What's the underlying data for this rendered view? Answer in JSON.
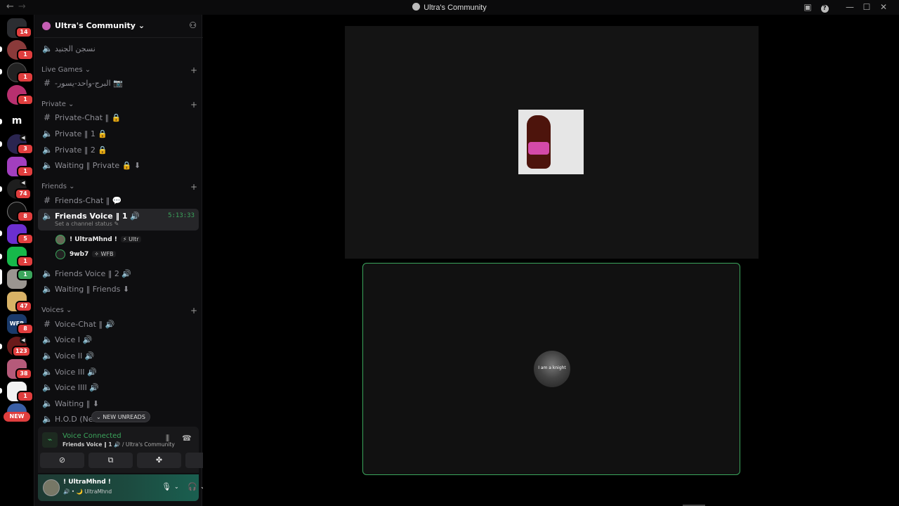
{
  "titlebar": {
    "back": "←",
    "forward": "→",
    "title": "Ultra's Community",
    "inbox_icon": "▣",
    "help_icon": "?",
    "minimize": "—",
    "maximize": "☐",
    "close": "✕"
  },
  "rail": {
    "badges": [
      "14",
      "1",
      "1",
      "1",
      "3",
      "1",
      "74",
      "8",
      "5",
      "1",
      "1",
      "47",
      "8",
      "123",
      "38",
      "1"
    ],
    "new_label": "NEW"
  },
  "server": {
    "name": "Ultra's Community",
    "chevron": "⌄",
    "invite_icon": "⚇"
  },
  "channels": {
    "top": "نسجن الجنيد",
    "live_games_cat": "Live Games",
    "live_games_1": "-البرج-واحد-يسور 📷",
    "private_cat": "Private",
    "private_chat": "Private-Chat ‖ 🔒",
    "private_1": "Private ‖ 1 🔒",
    "private_2": "Private ‖ 2 🔒",
    "waiting_private": "Waiting ‖ Private 🔒 ⬇",
    "friends_cat": "Friends",
    "friends_chat": "Friends-Chat ‖ 💬",
    "friends_voice_1": "Friends Voice ‖ 1 🔊",
    "friends_voice_1_timer": "5:13:33",
    "friends_voice_1_status": "Set a channel status ✎",
    "member1_name": "! UltraMhnd !",
    "member1_tag": "⚡ Ultr",
    "member2_name": "9wb7",
    "member2_tag": "✧ WFB",
    "friends_voice_2": "Friends Voice ‖ 2 🔊",
    "waiting_friends": "Waiting ‖ Friends ⬇",
    "voices_cat": "Voices",
    "voice_chat": "Voice-Chat ‖ 🔊",
    "voice_i": "Voice I 🔊",
    "voice_ii": "Voice II 🔊",
    "voice_iii": "Voice III 🔊",
    "voice_iiii": "Voice IIII 🔊",
    "waiting": "Waiting ‖ ⬇",
    "hod": "H.O.D (Next",
    "new_unreads": "NEW UNREADS"
  },
  "voice_panel": {
    "status": "Voice Connected",
    "channel": "Friends Voice ‖ 1 🔊",
    "server": " / Ultra's Community"
  },
  "user": {
    "name": "! UltraMhnd !",
    "status": "🔊 • 🌙 UltraMhnd"
  },
  "tiles": {
    "avatar_text": "I am a knight"
  },
  "colors": {
    "accent_green": "#3ba55c",
    "badge_red": "#e03e3e"
  }
}
